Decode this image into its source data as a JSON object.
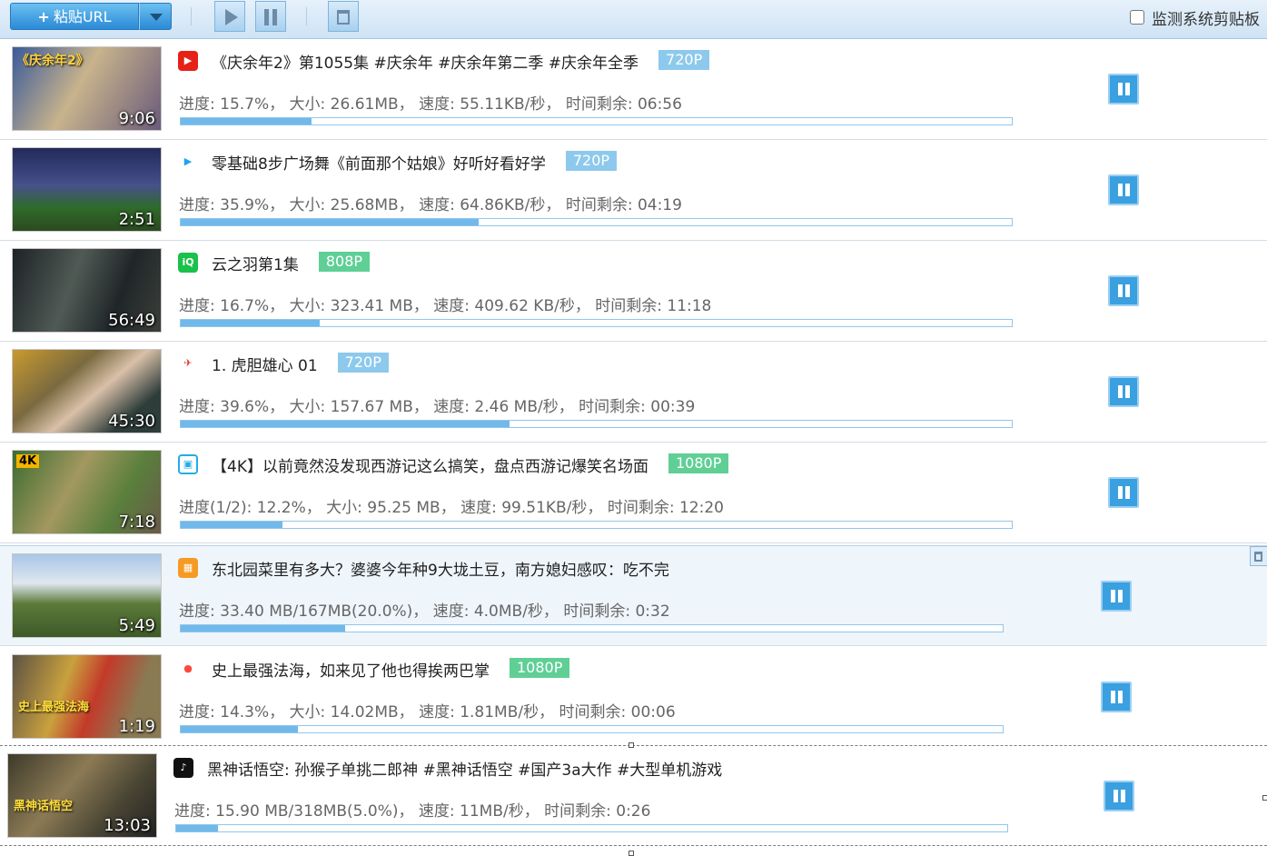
{
  "toolbar": {
    "paste_plus": "+",
    "paste_label": "粘贴URL",
    "monitor_label": "监测系统剪贴板"
  },
  "downloads": [
    {
      "title": "《庆余年2》第1055集   #庆余年 #庆余年第二季 #庆余年全季",
      "resolution": "720P",
      "res_color": "blue",
      "progress_text": "进度: 15.7%， 大小: 26.61MB， 速度: 55.11KB/秒， 时间剩余: 06:56",
      "progress": 0.157,
      "duration": "9:06",
      "thumb_caption": "《庆余年2》",
      "site": "youtube"
    },
    {
      "title": "零基础8步广场舞《前面那个姑娘》好听好看好学",
      "resolution": "720P",
      "res_color": "blue",
      "progress_text": "进度: 35.9%， 大小: 25.68MB， 速度: 64.86KB/秒， 时间剩余: 04:19",
      "progress": 0.359,
      "duration": "2:51",
      "thumb_caption": "",
      "site": "tencent-video"
    },
    {
      "title": "云之羽第1集",
      "resolution": "808P",
      "res_color": "green",
      "progress_text": "进度: 16.7%， 大小: 323.41 MB， 速度: 409.62 KB/秒， 时间剩余:  11:18",
      "progress": 0.167,
      "duration": "56:49",
      "thumb_caption": "",
      "site": "iqiyi"
    },
    {
      "title": "1. 虎胆雄心 01",
      "resolution": "720P",
      "res_color": "blue",
      "progress_text": "进度: 39.6%， 大小: 157.67 MB， 速度: 2.46 MB/秒， 时间剩余:  00:39",
      "progress": 0.396,
      "duration": "45:30",
      "thumb_caption": "",
      "site": "cctv"
    },
    {
      "title": "【4K】以前竟然没发现西游记这么搞笑，盘点西游记爆笑名场面",
      "resolution": "1080P",
      "res_color": "green",
      "progress_text": "进度(1/2): 12.2%， 大小: 95.25 MB， 速度: 99.51KB/秒， 时间剩余: 12:20",
      "progress": 0.122,
      "duration": "7:18",
      "thumb_caption": "4K",
      "site": "bilibili"
    },
    {
      "title": "东北园菜里有多大？婆婆今年种9大垅土豆，南方媳妇感叹：吃不完",
      "resolution": "",
      "res_color": "",
      "progress_text": "进度: 33.40 MB/167MB(20.0%)， 速度: 4.0MB/秒， 时间剩余: 0:32",
      "progress": 0.2,
      "duration": "5:49",
      "thumb_caption": "",
      "site": "xigua"
    },
    {
      "title": "史上最强法海，如来见了他也得挨两巴掌",
      "resolution": "1080P",
      "res_color": "green",
      "progress_text": "进度: 14.3%， 大小: 14.02MB， 速度: 1.81MB/秒， 时间剩余: 00:06",
      "progress": 0.143,
      "duration": "1:19",
      "thumb_caption": "史上最强法海",
      "site": "kuaishou"
    },
    {
      "title": "黑神话悟空: 孙猴子单挑二郎神 #黑神话悟空 #国产3a大作 #大型单机游戏",
      "resolution": "",
      "res_color": "",
      "progress_text": "进度: 15.90 MB/318MB(5.0%)， 速度: 11MB/秒， 时间剩余: 0:26",
      "progress": 0.05,
      "duration": "13:03",
      "thumb_caption": "黑神话悟空",
      "site": "douyin"
    }
  ]
}
